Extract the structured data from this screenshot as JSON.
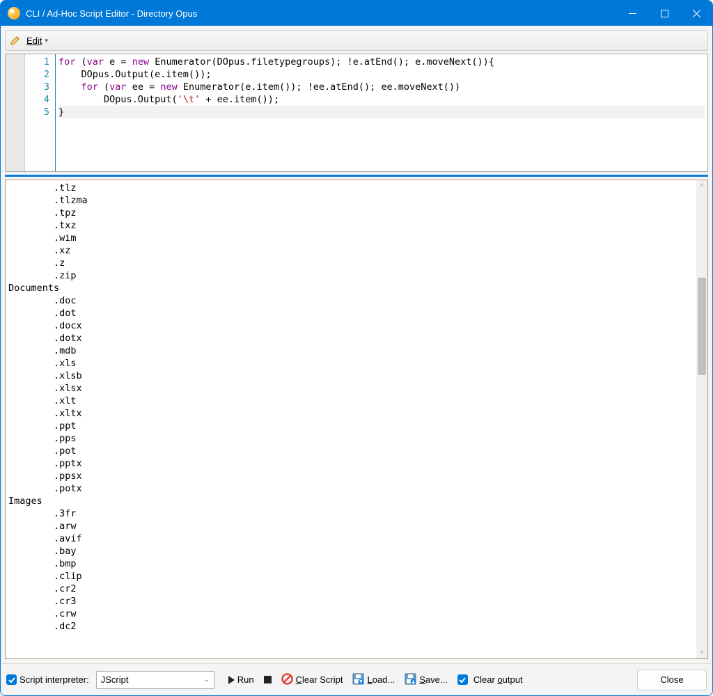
{
  "title": "CLI / Ad-Hoc Script Editor - Directory Opus",
  "menu": {
    "edit": "Edit"
  },
  "code": {
    "lines": [
      "1",
      "2",
      "3",
      "4",
      "5"
    ],
    "line1_kw1": "for",
    "line1_p1": " (",
    "line1_kw2": "var",
    "line1_p2": " e = ",
    "line1_kw3": "new",
    "line1_p3": " Enumerator(DOpus.filetypegroups); !e.atEnd(); e.moveNext()){",
    "line2": "    DOpus.Output(e.item());",
    "line3_pad": "    ",
    "line3_kw1": "for",
    "line3_p1": " (",
    "line3_kw2": "var",
    "line3_p2": " ee = ",
    "line3_kw3": "new",
    "line3_p3": " Enumerator(e.item()); !ee.atEnd(); ee.moveNext())",
    "line4_pad": "        DOpus.Output(",
    "line4_str": "'\\t'",
    "line4_end": " + ee.item());",
    "line5": "}"
  },
  "output": "        .tlz\n        .tlzma\n        .tpz\n        .txz\n        .wim\n        .xz\n        .z\n        .zip\nDocuments\n        .doc\n        .dot\n        .docx\n        .dotx\n        .mdb\n        .xls\n        .xlsb\n        .xlsx\n        .xlt\n        .xltx\n        .ppt\n        .pps\n        .pot\n        .pptx\n        .ppsx\n        .potx\nImages\n        .3fr\n        .arw\n        .avif\n        .bay\n        .bmp\n        .clip\n        .cr2\n        .cr3\n        .crw\n        .dc2",
  "bottom": {
    "interpreter_label": "Script interpreter:",
    "interpreter_value": "JScript",
    "run": "Run",
    "clear_script_pre": "",
    "clear_script_u": "C",
    "clear_script_post": "lear Script",
    "load_u": "L",
    "load_post": "oad...",
    "save_u": "S",
    "save_post": "ave...",
    "clearout_pre": "Clear ",
    "clearout_u": "o",
    "clearout_post": "utput",
    "close": "Close"
  }
}
